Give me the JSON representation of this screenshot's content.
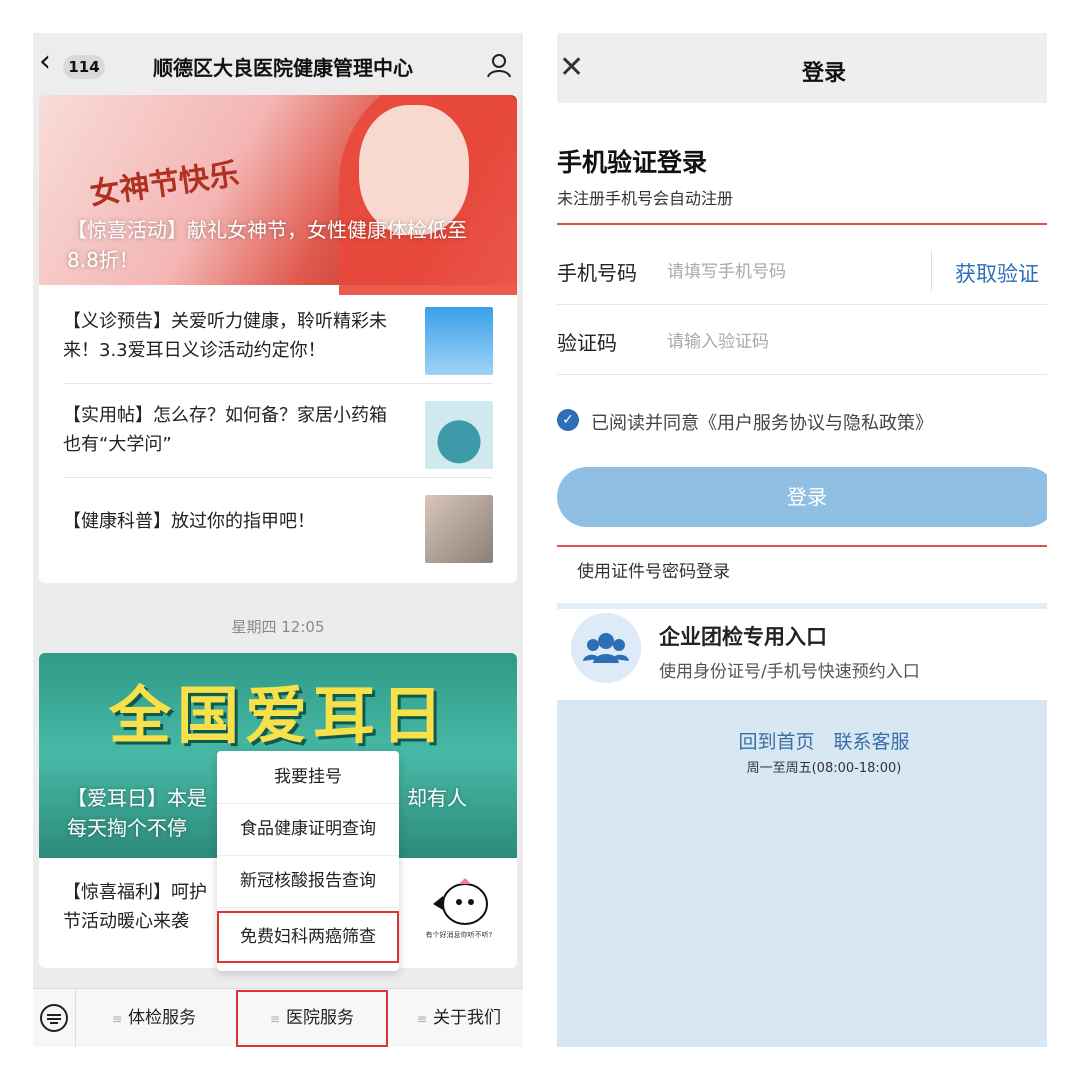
{
  "left_phone": {
    "back_count": "114",
    "title": "顺德区大良医院健康管理中心",
    "banner1": {
      "art_title": "女神节快乐",
      "caption": "【惊喜活动】献礼女神节，女性健康体检低至8.8折！"
    },
    "articles": [
      {
        "text": "【义诊预告】关爱听力健康，聆听精彩未来！3.3爱耳日义诊活动约定你！"
      },
      {
        "text": "【实用帖】怎么存？如何备？家居小药箱也有“大学问”"
      },
      {
        "text": "【健康科普】放过你的指甲吧！"
      }
    ],
    "timestamp": "星期四 12:05",
    "banner2": {
      "big_title": "全国爱耳日",
      "caption_a": "【爱耳日】本是",
      "caption_b": "却有人",
      "caption_c": "每天掏个不停"
    },
    "bottom_article": {
      "line1": "【惊喜福利】呵护",
      "line2": "节活动暖心来袭",
      "thumb_caption": "有个好消息你听不听?"
    },
    "popup_menu": [
      "我要挂号",
      "食品健康证明查询",
      "新冠核酸报告查询",
      "免费妇科两癌筛查"
    ],
    "tabs": [
      "体检服务",
      "医院服务",
      "关于我们"
    ]
  },
  "right_phone": {
    "title": "登录",
    "heading": "手机验证登录",
    "subheading": "未注册手机号会自动注册",
    "phone_label": "手机号码",
    "phone_placeholder": "请填写手机号码",
    "get_code": "获取验证",
    "code_label": "验证码",
    "code_placeholder": "请输入验证码",
    "agreement": "已阅读并同意《用户服务协议与隐私政策》",
    "login_button": "登录",
    "password_login": "使用证件号密码登录",
    "enterprise_title": "企业团检专用入口",
    "enterprise_sub": "使用身份证号/手机号快速预约入口",
    "footer_links": "回到首页　联系客服",
    "footer_hours": "周一至周五(08:00-18:00)"
  },
  "colors": {
    "accent_blue": "#2c6fb7",
    "login_button": "#8fc0e3",
    "highlight_red": "#d33333"
  }
}
